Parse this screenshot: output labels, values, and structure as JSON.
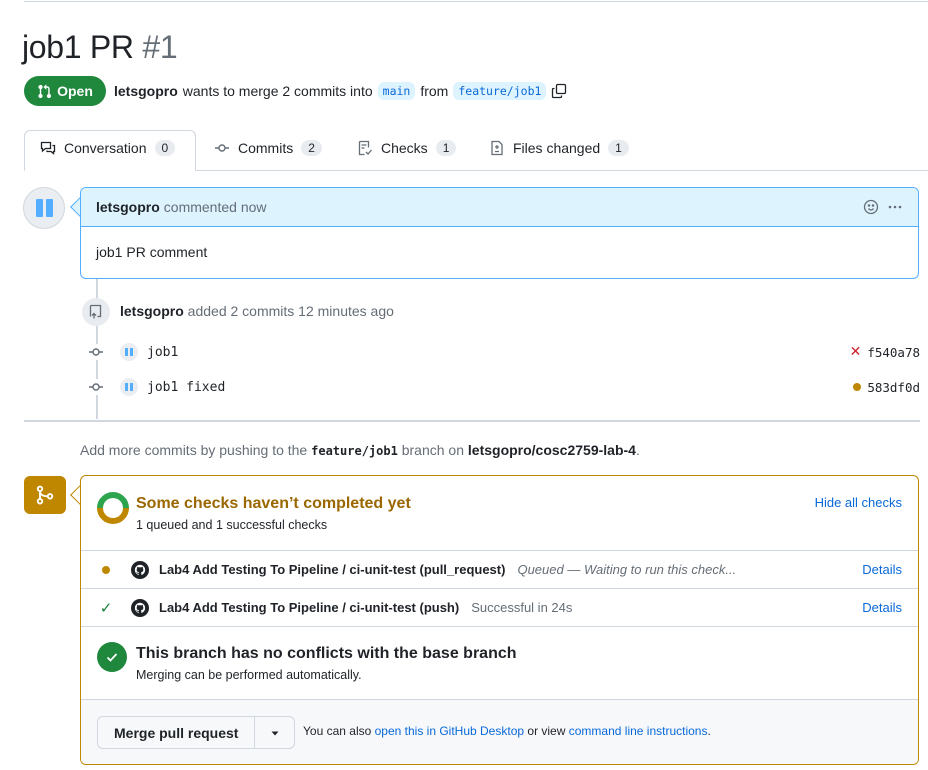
{
  "pr": {
    "title": "job1 PR",
    "number": "#1",
    "state": "Open",
    "author": "letsgopro",
    "merge_text_1": "wants to merge 2 commits into",
    "base_branch": "main",
    "merge_text_2": "from",
    "head_branch": "feature/job1"
  },
  "tabs": [
    {
      "label": "Conversation",
      "count": "0",
      "icon": "comment-discussion-icon"
    },
    {
      "label": "Commits",
      "count": "2",
      "icon": "git-commit-icon"
    },
    {
      "label": "Checks",
      "count": "1",
      "icon": "checklist-icon"
    },
    {
      "label": "Files changed",
      "count": "1",
      "icon": "file-diff-icon"
    }
  ],
  "comment": {
    "author": "letsgopro",
    "meta": "commented now",
    "body": "job1 PR comment"
  },
  "push_event": {
    "author": "letsgopro",
    "text": "added 2 commits 12 minutes ago"
  },
  "commits": [
    {
      "message": "job1",
      "sha": "f540a78",
      "status": "failure"
    },
    {
      "message": "job1 fixed",
      "sha": "583df0d",
      "status": "pending"
    }
  ],
  "hint": {
    "prefix": "Add more commits by pushing to the",
    "branch": "feature/job1",
    "middle": "branch on",
    "repo": "letsgopro/cosc2759-lab-4",
    "suffix": "."
  },
  "checks_summary": {
    "title": "Some checks haven’t completed yet",
    "subtitle": "1 queued and 1 successful checks",
    "hide_label": "Hide all checks"
  },
  "checks": [
    {
      "name": "Lab4 Add Testing To Pipeline / ci-unit-test (pull_request)",
      "desc": "Queued — Waiting to run this check...",
      "status": "queued",
      "details": "Details"
    },
    {
      "name": "Lab4 Add Testing To Pipeline / ci-unit-test (push)",
      "desc": "Successful in 24s",
      "status": "success",
      "details": "Details"
    }
  ],
  "conflicts": {
    "title": "This branch has no conflicts with the base branch",
    "subtitle": "Merging can be performed automatically."
  },
  "merge_footer": {
    "button": "Merge pull request",
    "text_1": "You can also",
    "link_1": "open this in GitHub Desktop",
    "text_2": "or view",
    "link_2": "command line instructions",
    "text_3": "."
  },
  "colors": {
    "open_green": "#1f883d",
    "pending_yellow": "#bf8700",
    "link_blue": "#0969da",
    "fail_red": "#cf222e"
  }
}
